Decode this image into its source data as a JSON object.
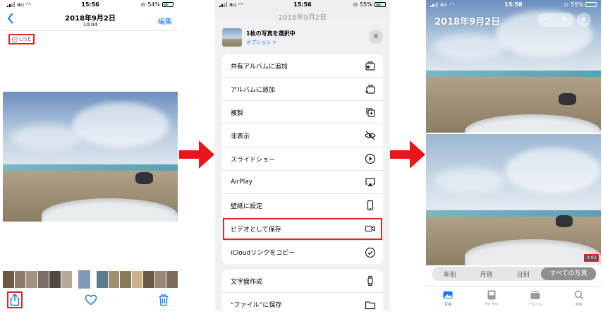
{
  "status": {
    "carrier": "au",
    "panel1": {
      "time": "15:56",
      "battery": "54%",
      "battery_level": 0.54
    },
    "panel2": {
      "time": "15:56",
      "battery": "55%",
      "battery_level": 0.55
    },
    "panel3": {
      "time": "15:58",
      "battery": "55%",
      "battery_level": 0.55
    }
  },
  "viewer": {
    "title": "2018年9月2日",
    "subtitle": "10:04",
    "edit_label": "編集",
    "live_label": "LIVE"
  },
  "share_sheet": {
    "background_title": "2018年9月2日",
    "header_title": "1枚の写真を選択中",
    "options_label": "オプション >",
    "actions": [
      {
        "label": "共有アルバムに追加",
        "icon": "shared-album-icon"
      },
      {
        "label": "アルバムに追加",
        "icon": "add-album-icon"
      },
      {
        "label": "複製",
        "icon": "duplicate-icon"
      },
      {
        "label": "非表示",
        "icon": "hide-eye-icon"
      },
      {
        "label": "スライドショー",
        "icon": "play-icon"
      },
      {
        "label": "AirPlay",
        "icon": "airplay-icon"
      },
      {
        "label": "壁紙に設定",
        "icon": "phone-icon"
      },
      {
        "label": "ビデオとして保存",
        "icon": "video-camera-icon",
        "highlighted": true
      },
      {
        "label": "iCloudリンクをコピー",
        "icon": "link-icon"
      }
    ],
    "actions2": [
      {
        "label": "文字盤作成",
        "icon": "watch-icon"
      },
      {
        "label": "“ファイル”に保存",
        "icon": "folder-icon"
      }
    ]
  },
  "library": {
    "title": "2018年9月2日",
    "zoom_out": "−",
    "zoom_in": "+",
    "duration": "0:03",
    "segments": [
      "年別",
      "月別",
      "日別",
      "すべての写真"
    ],
    "active_segment": "すべての写真",
    "tabs": [
      {
        "label": "写真",
        "icon": "photos-icon",
        "active": true
      },
      {
        "label": "For You",
        "icon": "for-you-icon"
      },
      {
        "label": "アルバム",
        "icon": "albums-icon"
      },
      {
        "label": "検索",
        "icon": "search-icon"
      }
    ]
  },
  "colors": {
    "accent": "#0a7aff",
    "highlight": "#e32222"
  }
}
